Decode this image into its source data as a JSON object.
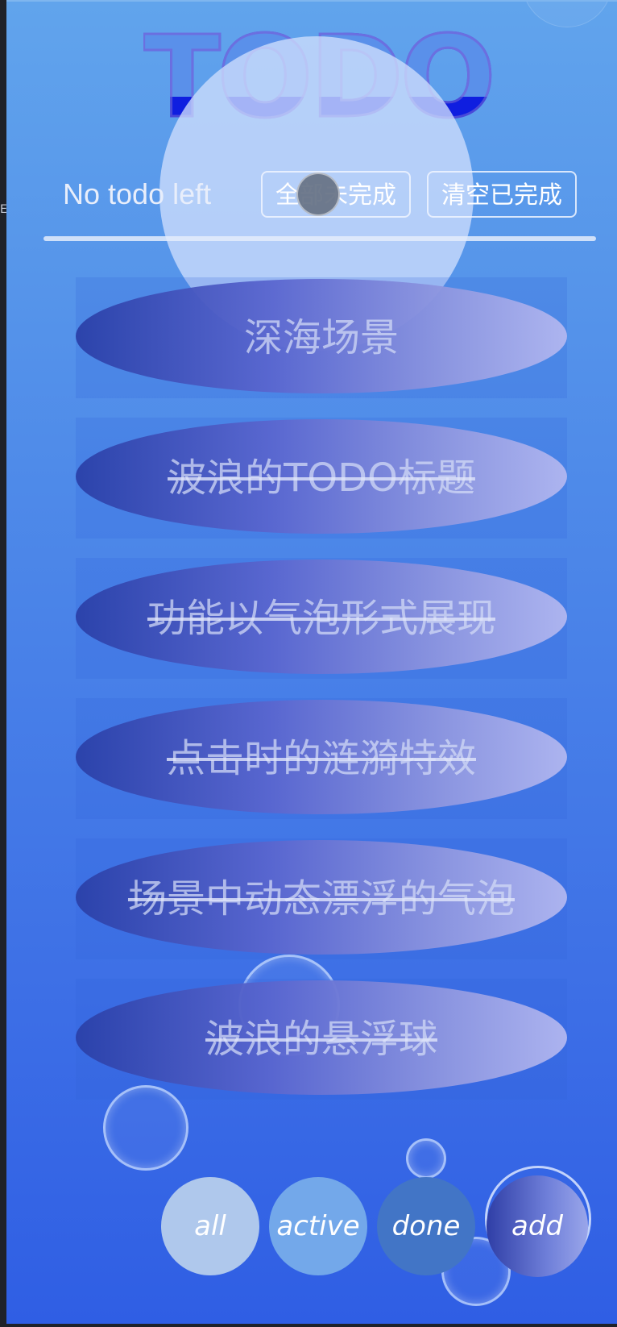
{
  "side_glyph": "E",
  "header": {
    "title": "TODO"
  },
  "status": {
    "count_text": "No todo left",
    "mark_all_label": "全部未完成",
    "clear_done_label": "清空已完成"
  },
  "todos": [
    {
      "text": "深海场景",
      "done": false
    },
    {
      "text": "波浪的TODO标题",
      "done": true
    },
    {
      "text": "功能以气泡形式展现",
      "done": true
    },
    {
      "text": "点击时的涟漪特效",
      "done": true
    },
    {
      "text": "场景中动态漂浮的气泡",
      "done": true
    },
    {
      "text": "波浪的悬浮球",
      "done": true
    }
  ],
  "filters": {
    "all": "all",
    "active": "active",
    "done": "done",
    "add": "add"
  },
  "colors": {
    "background_top": "#61a4ec",
    "background_bottom": "#2f5ee4",
    "title_fill": "#0f1ee0",
    "filter_all": "#afc8ec",
    "filter_active": "#73a8ea",
    "filter_done": "#4275c6"
  }
}
